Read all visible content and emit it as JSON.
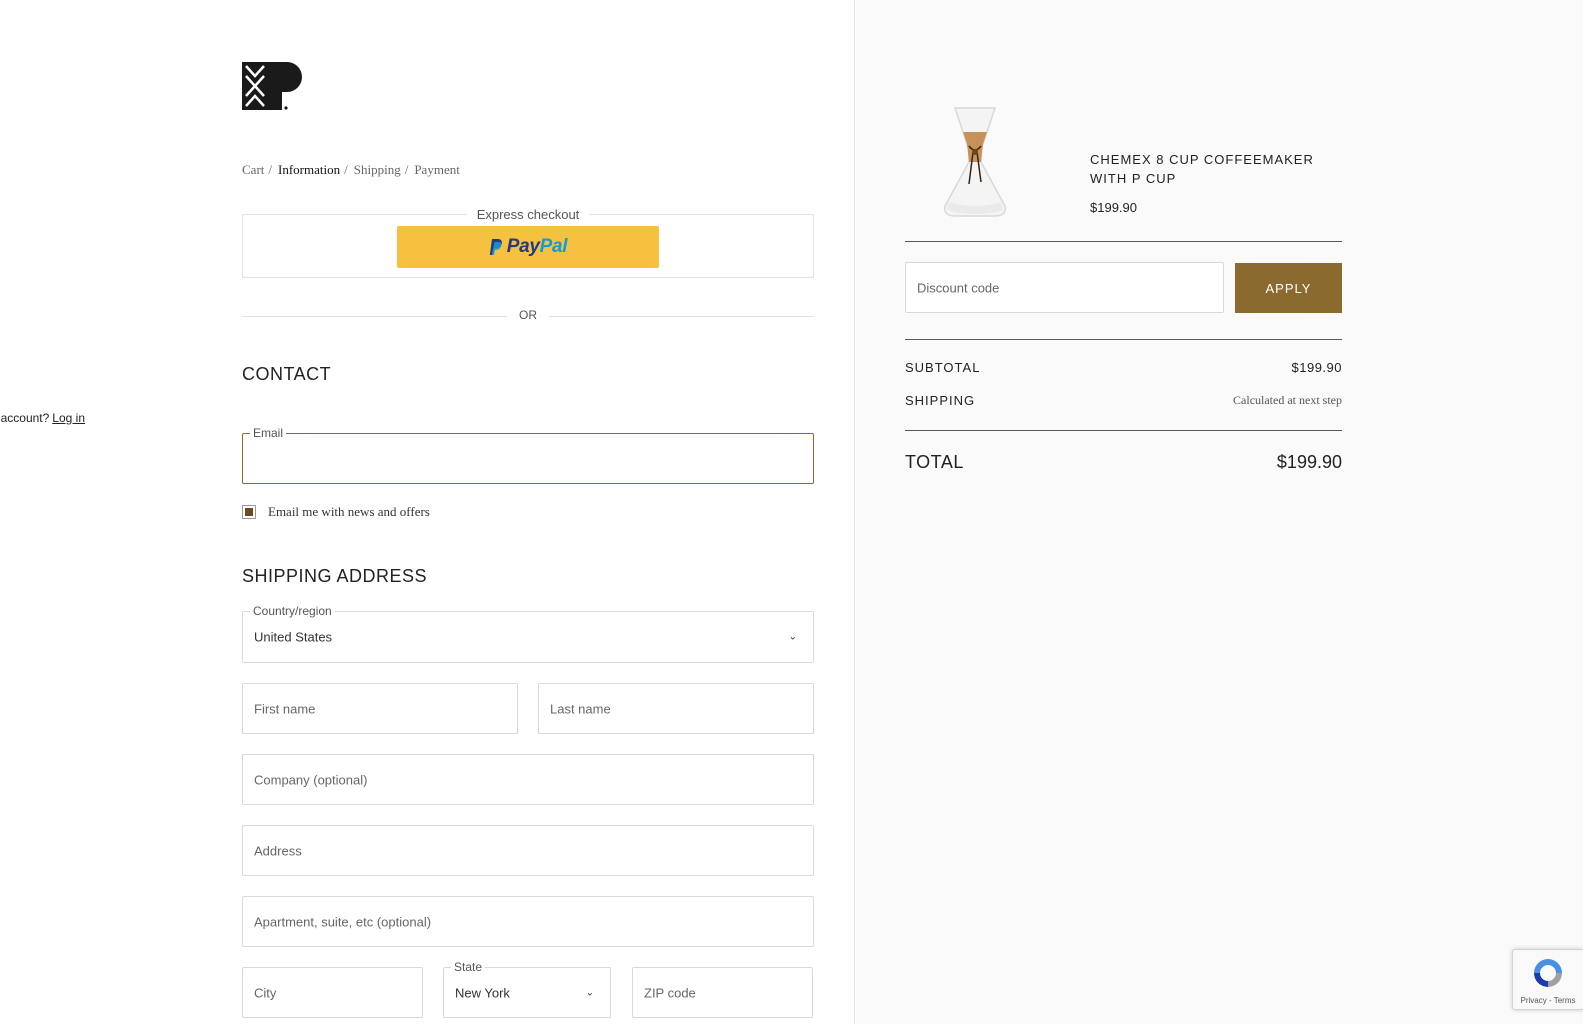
{
  "breadcrumb": {
    "cart": "Cart",
    "information": "Information",
    "shipping": "Shipping",
    "payment": "Payment",
    "sep": "/"
  },
  "express": {
    "title": "Express checkout",
    "paypal_p": "Pay",
    "paypal_pal": "Pal"
  },
  "or_label": "OR",
  "contact": {
    "heading": "CONTACT",
    "have_account": "Have an account?",
    "login_label": "Log in",
    "email_label": "Email",
    "email_value": "",
    "newsletter_label": "Email me with news and offers",
    "newsletter_checked": true
  },
  "shipping_address": {
    "heading": "SHIPPING ADDRESS",
    "country_label": "Country/region",
    "country_value": "United States",
    "first_name_placeholder": "First name",
    "last_name_placeholder": "Last name",
    "company_placeholder": "Company (optional)",
    "address_placeholder": "Address",
    "apartment_placeholder": "Apartment, suite, etc (optional)",
    "city_placeholder": "City",
    "state_label": "State",
    "state_value": "New York",
    "zip_placeholder": "ZIP code"
  },
  "order": {
    "product_name": "CHEMEX 8 CUP COFFEEMAKER WITH P CUP",
    "product_price": "$199.90",
    "discount_placeholder": "Discount code",
    "apply_label": "APPLY",
    "subtotal_label": "SUBTOTAL",
    "subtotal_value": "$199.90",
    "shipping_label": "SHIPPING",
    "shipping_value": "Calculated at next step",
    "total_label": "TOTAL",
    "total_value": "$199.90"
  },
  "recaptcha": {
    "terms": "Privacy - Terms"
  },
  "colors": {
    "accent": "#8a6a2e",
    "paypal_yellow": "#f6c13e",
    "paypal_dark": "#253b80",
    "paypal_light": "#179bd7"
  }
}
